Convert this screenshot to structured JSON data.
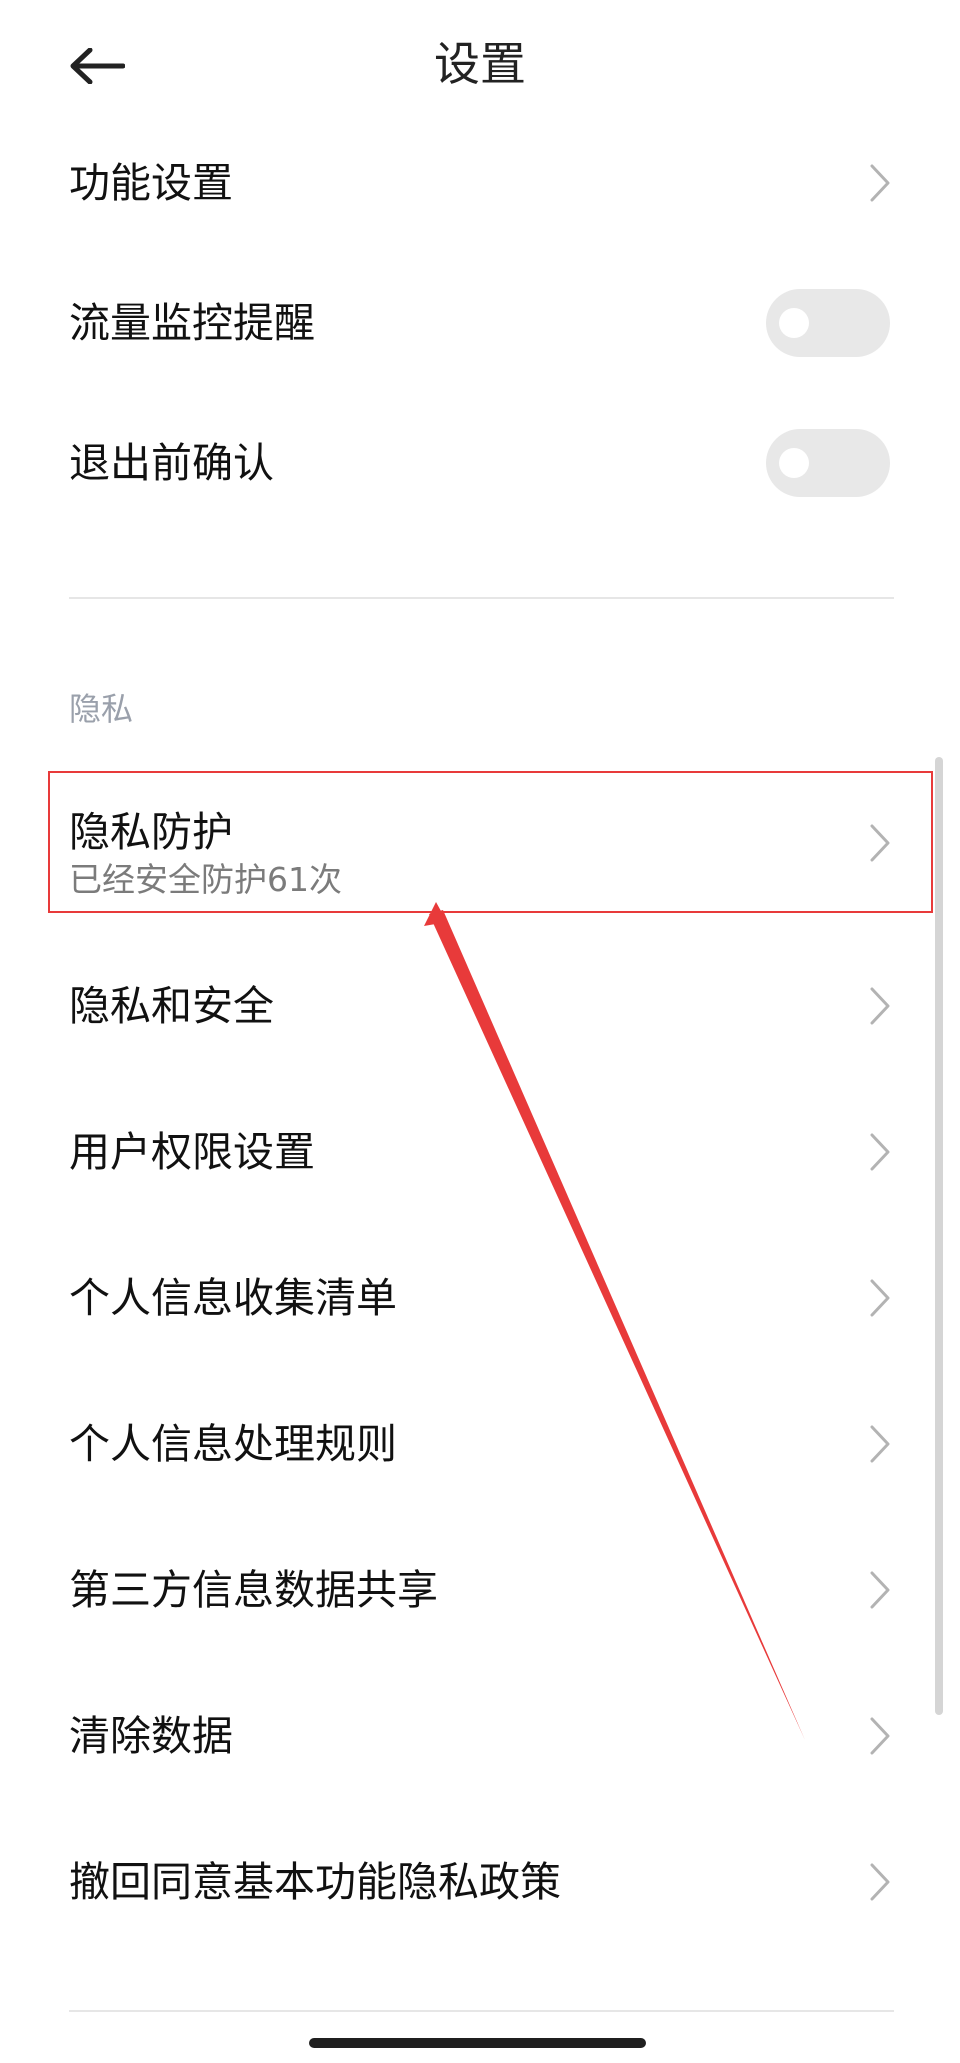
{
  "header": {
    "title": "设置",
    "back_icon": "back-arrow-icon"
  },
  "general_settings": [
    {
      "label": "功能设置",
      "control": "chevron"
    },
    {
      "label": "流量监控提醒",
      "control": "toggle",
      "enabled": false
    },
    {
      "label": "退出前确认",
      "control": "toggle",
      "enabled": false
    }
  ],
  "privacy_section": {
    "title": "隐私",
    "items": [
      {
        "label": "隐私防护",
        "subtitle": "已经安全防护61次",
        "control": "chevron"
      },
      {
        "label": "隐私和安全",
        "control": "chevron"
      },
      {
        "label": "用户权限设置",
        "control": "chevron"
      },
      {
        "label": "个人信息收集清单",
        "control": "chevron"
      },
      {
        "label": "个人信息处理规则",
        "control": "chevron"
      },
      {
        "label": "第三方信息数据共享",
        "control": "chevron"
      },
      {
        "label": "清除数据",
        "control": "chevron"
      },
      {
        "label": "撤回同意基本功能隐私政策",
        "control": "chevron"
      }
    ]
  },
  "annotation": {
    "highlight_color": "#e83a3a",
    "highlighted_item": "隐私防护"
  },
  "colors": {
    "text": "#111111",
    "subtitle": "#7b7b7b",
    "section_title": "#9aa0ab",
    "toggle_off": "#e8e8e8",
    "chevron": "#b3b3b3",
    "divider": "#e6e6e6"
  }
}
